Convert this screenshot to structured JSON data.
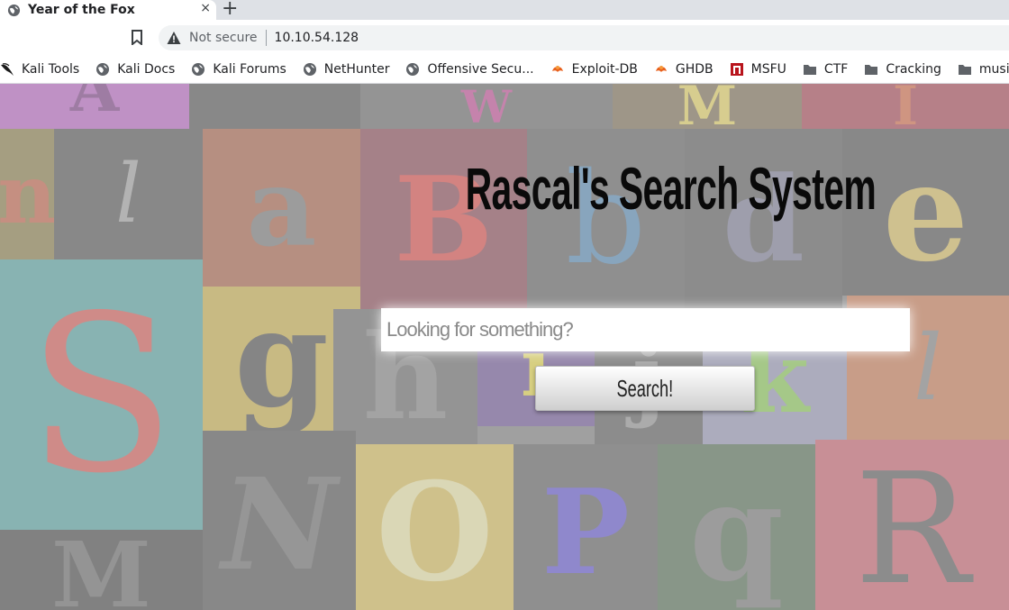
{
  "browser": {
    "tab_title": "Year of the Fox",
    "close_glyph": "×",
    "new_tab_glyph": "+",
    "security_text": "Not secure",
    "url": "10.10.54.128"
  },
  "bookmarks": [
    {
      "label": "Kali Tools",
      "icon": "kali-dragon-icon"
    },
    {
      "label": "Kali Docs",
      "icon": "globe-icon"
    },
    {
      "label": "Kali Forums",
      "icon": "globe-icon"
    },
    {
      "label": "NetHunter",
      "icon": "globe-icon"
    },
    {
      "label": "Offensive Secu...",
      "icon": "globe-icon"
    },
    {
      "label": "Exploit-DB",
      "icon": "exploitdb-icon"
    },
    {
      "label": "GHDB",
      "icon": "exploitdb-icon"
    },
    {
      "label": "MSFU",
      "icon": "msfu-icon"
    },
    {
      "label": "CTF",
      "icon": "folder-icon"
    },
    {
      "label": "Cracking",
      "icon": "folder-icon"
    },
    {
      "label": "music",
      "icon": "folder-icon"
    }
  ],
  "page": {
    "title": "Rascal's Search System",
    "search_placeholder": "Looking for something?",
    "search_button": "Search!"
  },
  "colors": {
    "tab_strip": "#dee1e6",
    "omnibox": "#f1f3f4",
    "page_veil": "#c8c8c8",
    "title_text": "#0a0a0a"
  }
}
